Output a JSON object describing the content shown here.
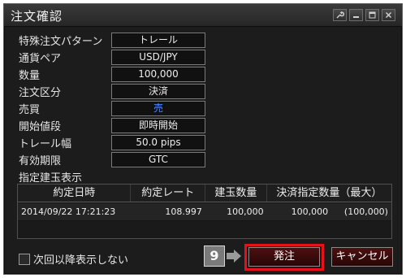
{
  "window": {
    "title": "注文確認"
  },
  "details": [
    {
      "label": "特殊注文パターン",
      "value": "トレール"
    },
    {
      "label": "通貨ペア",
      "value": "USD/JPY"
    },
    {
      "label": "数量",
      "value": "100,000"
    },
    {
      "label": "注文区分",
      "value": "決済"
    },
    {
      "label": "売買",
      "value": "売"
    },
    {
      "label": "開始値段",
      "value": "即時開始"
    },
    {
      "label": "トレール幅",
      "value": "50.0 pips"
    },
    {
      "label": "有効期限",
      "value": "GTC"
    }
  ],
  "positions": {
    "section_title": "指定建玉表示",
    "headers": [
      "約定日時",
      "約定レート",
      "建玉数量",
      "決済指定数量（最大）"
    ],
    "rows": [
      {
        "datetime": "2014/09/22 17:21:23",
        "rate": "108.997",
        "qty": "100,000",
        "settle": "100,000",
        "settle_max": "(100,000)"
      }
    ]
  },
  "footer": {
    "checkbox_label": "次回以降表示しない",
    "step_number": "9",
    "order_button": "発注",
    "cancel_button": "キャンセル"
  },
  "colors": {
    "background": "#1c1c1c",
    "sell": "#4d8dff",
    "highlight": "#e8101a",
    "button": "#3a0a0a"
  },
  "icons": {
    "titlebar": [
      "wrench-icon",
      "minimize-icon",
      "maximize-icon",
      "close-icon"
    ]
  }
}
